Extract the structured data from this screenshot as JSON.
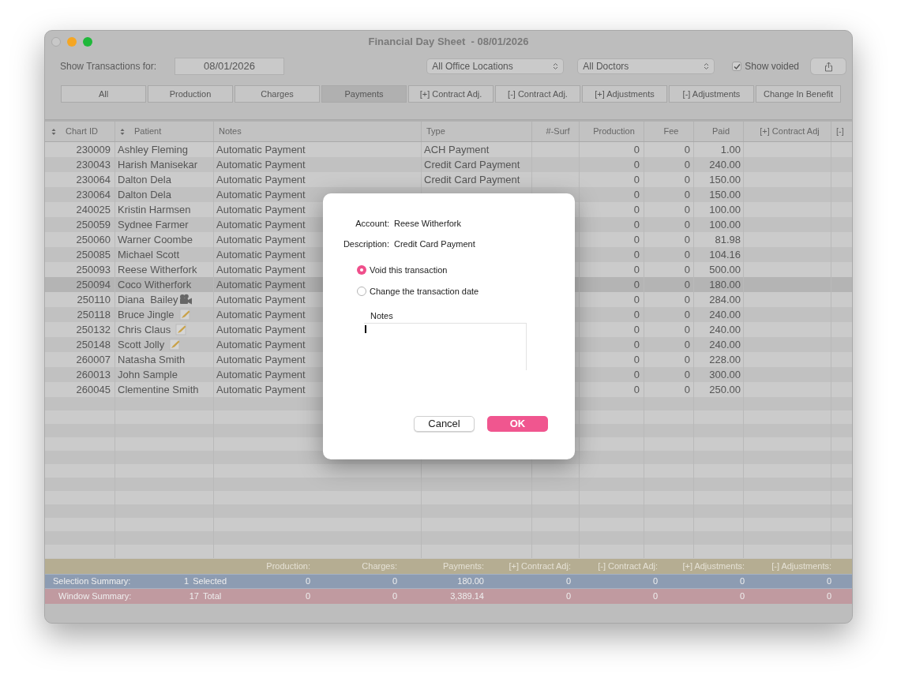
{
  "window": {
    "title": "Financial Day Sheet  - 08/01/2026"
  },
  "toolbar": {
    "date_label": "Show Transactions for:",
    "date": "08/01/2026",
    "location": "All Office Locations",
    "doctor": "All Doctors",
    "show_voided": {
      "label": "Show voided",
      "checked": true
    }
  },
  "filters": [
    {
      "label": "All",
      "selected": false
    },
    {
      "label": "Production",
      "selected": false
    },
    {
      "label": "Charges",
      "selected": false
    },
    {
      "label": "Payments",
      "selected": true
    },
    {
      "label": "[+] Contract Adj.",
      "selected": false
    },
    {
      "label": "[-] Contract Adj.",
      "selected": false
    },
    {
      "label": "[+] Adjustments",
      "selected": false
    },
    {
      "label": "[-] Adjustments",
      "selected": false
    },
    {
      "label": "Change In Benefit",
      "selected": false
    }
  ],
  "table": {
    "columns": [
      {
        "label": "Chart ID",
        "sortable": true
      },
      {
        "label": "Patient",
        "sortable": true
      },
      {
        "label": "Notes",
        "sortable": false
      },
      {
        "label": "Type",
        "sortable": false
      },
      {
        "label": "#-Surf",
        "sortable": false
      },
      {
        "label": "Production",
        "sortable": false
      },
      {
        "label": "Fee",
        "sortable": false
      },
      {
        "label": "Paid",
        "sortable": false
      },
      {
        "label": "[+] Contract Adj",
        "sortable": false
      },
      {
        "label": "[-]",
        "sortable": false
      }
    ],
    "rows": [
      {
        "chart_id": "230009",
        "patient": "Ashley Fleming",
        "notes": "Automatic Payment",
        "type": "ACH Payment",
        "production": "0",
        "fee": "0",
        "paid": "1.00",
        "selected": false
      },
      {
        "chart_id": "230043",
        "patient": "Harish Manisekar",
        "notes": "Automatic Payment",
        "type": "Credit Card Payment",
        "production": "0",
        "fee": "0",
        "paid": "240.00",
        "selected": false
      },
      {
        "chart_id": "230064",
        "patient": "Dalton Dela",
        "notes": "Automatic Payment",
        "type": "Credit Card Payment",
        "production": "0",
        "fee": "0",
        "paid": "150.00",
        "selected": false
      },
      {
        "chart_id": "230064",
        "patient": "Dalton Dela",
        "notes": "Automatic Payment",
        "production": "0",
        "fee": "0",
        "paid": "150.00",
        "selected": false
      },
      {
        "chart_id": "240025",
        "patient": "Kristin Harmsen",
        "notes": "Automatic Payment",
        "production": "0",
        "fee": "0",
        "paid": "100.00",
        "selected": false
      },
      {
        "chart_id": "250059",
        "patient": "Sydnee Farmer",
        "notes": "Automatic Payment",
        "production": "0",
        "fee": "0",
        "paid": "100.00",
        "selected": false
      },
      {
        "chart_id": "250060",
        "patient": "Warner Coombe",
        "notes": "Automatic Payment",
        "production": "0",
        "fee": "0",
        "paid": "81.98",
        "selected": false
      },
      {
        "chart_id": "250085",
        "patient": "Michael Scott",
        "notes": "Automatic Payment",
        "production": "0",
        "fee": "0",
        "paid": "104.16",
        "selected": false
      },
      {
        "chart_id": "250093",
        "patient": "Reese Witherfork",
        "notes": "Automatic Payment",
        "production": "0",
        "fee": "0",
        "paid": "500.00",
        "selected": false
      },
      {
        "chart_id": "250094",
        "patient": "Coco Witherfork",
        "notes": "Automatic Payment",
        "production": "0",
        "fee": "0",
        "paid": "180.00",
        "selected": true
      },
      {
        "chart_id": "250110",
        "patient": "Diana  Bailey",
        "badge": {
          "kind": "camera"
        },
        "notes": "Automatic Payment",
        "production": "0",
        "fee": "0",
        "paid": "284.00",
        "selected": false
      },
      {
        "chart_id": "250118",
        "patient": "Bruce Jingle",
        "badge": {
          "kind": "note"
        },
        "notes": "Automatic Payment",
        "production": "0",
        "fee": "0",
        "paid": "240.00",
        "selected": false
      },
      {
        "chart_id": "250132",
        "patient": "Chris Claus",
        "badge": {
          "kind": "note"
        },
        "notes": "Automatic Payment",
        "production": "0",
        "fee": "0",
        "paid": "240.00",
        "selected": false
      },
      {
        "chart_id": "250148",
        "patient": "Scott Jolly",
        "badge": {
          "kind": "note"
        },
        "notes": "Automatic Payment",
        "production": "0",
        "fee": "0",
        "paid": "240.00",
        "selected": false
      },
      {
        "chart_id": "260007",
        "patient": "Natasha Smith",
        "notes": "Automatic Payment",
        "production": "0",
        "fee": "0",
        "paid": "228.00",
        "selected": false
      },
      {
        "chart_id": "260013",
        "patient": "John Sample",
        "notes": "Automatic Payment",
        "production": "0",
        "fee": "0",
        "paid": "300.00",
        "selected": false
      },
      {
        "chart_id": "260045",
        "patient": "Clementine Smith",
        "notes": "Automatic Payment",
        "production": "0",
        "fee": "0",
        "paid": "250.00",
        "selected": false
      }
    ]
  },
  "summary": {
    "columns": [
      "Production:",
      "Charges:",
      "Payments:",
      "[+] Contract Adj:",
      "[-] Contract Adj:",
      "[+] Adjustments:",
      "[-] Adjustments:"
    ],
    "rows": [
      {
        "kind": "selection",
        "label": "Selection Summary:",
        "count": "1",
        "count_label": "Selected",
        "values": [
          "0",
          "0",
          "180.00",
          "0",
          "0",
          "0",
          "0"
        ]
      },
      {
        "kind": "window",
        "label": "Window Summary:",
        "count": "17",
        "count_label": "Total",
        "values": [
          "0",
          "0",
          "3,389.14",
          "0",
          "0",
          "0",
          "0"
        ]
      }
    ]
  },
  "dialog": {
    "account_label": "Account:",
    "account": "Reese Witherfork",
    "description_label": "Description:",
    "description": "Credit Card Payment",
    "options": [
      {
        "label": "Void this transaction",
        "selected": true
      },
      {
        "label": "Change the transaction date",
        "selected": false
      }
    ],
    "notes_label": "Notes",
    "buttons": [
      {
        "label": "Cancel",
        "kind": "secondary"
      },
      {
        "label": "OK",
        "kind": "primary"
      }
    ]
  }
}
